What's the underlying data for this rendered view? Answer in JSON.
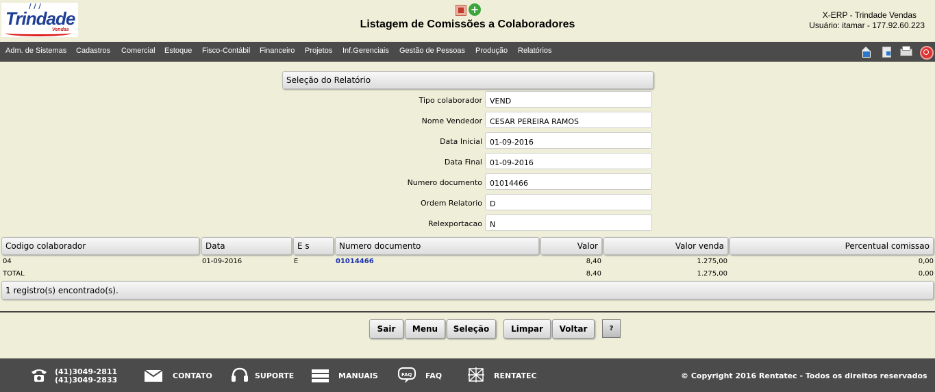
{
  "header": {
    "logo_text": "Trindade",
    "logo_sub": "Vendas",
    "title": "Listagem de Comissões a Colaboradores",
    "system_name": "X-ERP - Trindade Vendas",
    "user_line": "Usuário: itamar - 177.92.60.223",
    "icons": [
      "export-icon",
      "add-icon"
    ]
  },
  "menu": [
    "Adm. de Sistemas",
    "Cadastros",
    "Comercial",
    "Estoque",
    "Fisco-Contábil",
    "Financeiro",
    "Projetos",
    "Inf.Gerenciais",
    "Gestão de Pessoas",
    "Produção",
    "Relatórios"
  ],
  "menu_icons": [
    "home-icon",
    "document-icon",
    "print-icon",
    "exit-icon"
  ],
  "selection": {
    "title": "Seleção do Relatório",
    "fields": [
      {
        "label": "Tipo colaborador",
        "value": "VEND"
      },
      {
        "label": "Nome Vendedor",
        "value": "CESAR PEREIRA RAMOS"
      },
      {
        "label": "Data Inicial",
        "value": "01-09-2016"
      },
      {
        "label": "Data Final",
        "value": "01-09-2016"
      },
      {
        "label": "Numero documento",
        "value": "01014466"
      },
      {
        "label": "Ordem Relatorio",
        "value": "D"
      },
      {
        "label": "Relexportacao",
        "value": "N"
      }
    ]
  },
  "table": {
    "columns": [
      "Codigo colaborador",
      "Data",
      "E s",
      "Numero documento",
      "Valor",
      "Valor venda",
      "Percentual comissao"
    ],
    "rows": [
      [
        "04",
        "01-09-2016",
        "E",
        "01014466",
        "8,40",
        "1.275,00",
        "0,00"
      ]
    ],
    "total": {
      "label": "TOTAL",
      "valor": "8,40",
      "valor_venda": "1.275,00",
      "percentual": "0,00"
    },
    "summary": "1 registro(s) encontrado(s)."
  },
  "buttons": {
    "sair": "Sair",
    "menu": "Menu",
    "selecao": "Seleção",
    "limpar": "Limpar",
    "voltar": "Voltar",
    "help": "?"
  },
  "footer": {
    "phone1": "(41)3049-2811",
    "phone2": "(41)3049-2833",
    "contato": "CONTATO",
    "suporte": "SUPORTE",
    "manuais": "MANUAIS",
    "faq": "FAQ",
    "faq_icon_text": "FAQ",
    "rentatec": "RENTATEC",
    "copyright": "© Copyright 2016 Rentatec - Todos os direitos reservados"
  }
}
